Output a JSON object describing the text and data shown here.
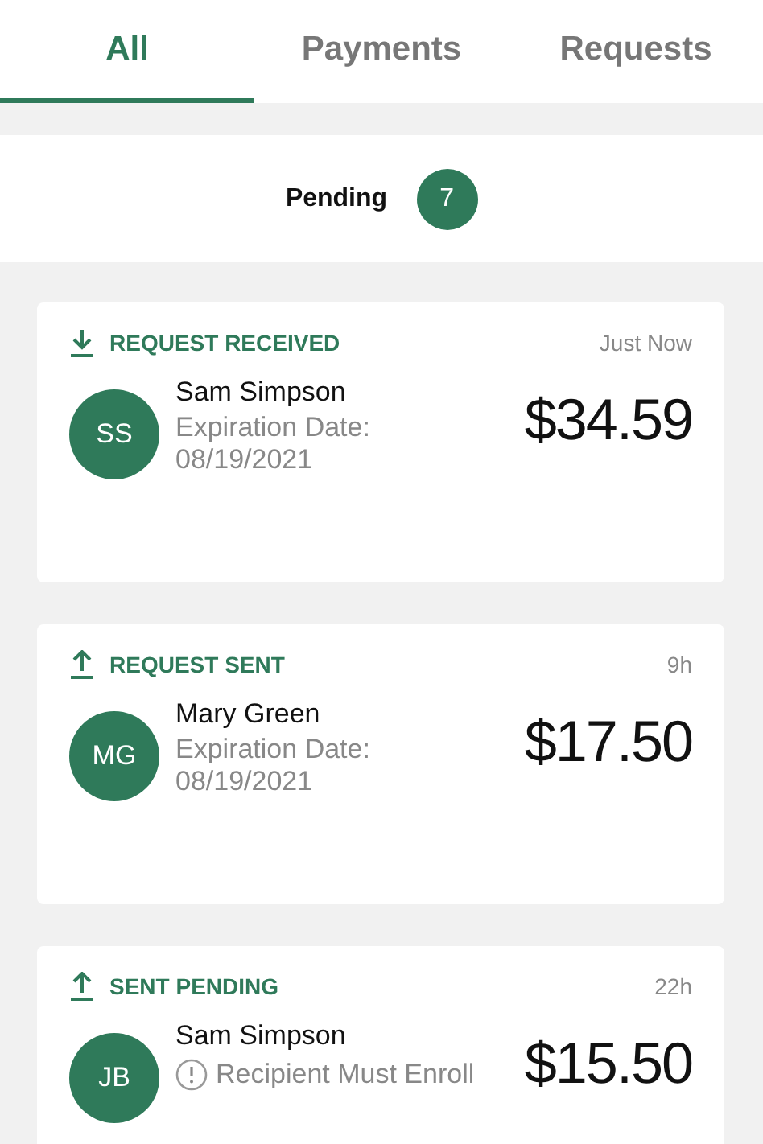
{
  "tabs": [
    {
      "label": "All",
      "selected": true
    },
    {
      "label": "Payments",
      "selected": false
    },
    {
      "label": "Requests",
      "selected": false
    }
  ],
  "pending": {
    "label": "Pending",
    "count": "7"
  },
  "transactions": [
    {
      "kind": "received",
      "status": "REQUEST RECEIVED",
      "time": "Just Now",
      "initials": "SS",
      "name": "Sam Simpson",
      "detail": {
        "kind": "plain",
        "text": "Expiration Date: 08/19/2021"
      },
      "amount": "$34.59"
    },
    {
      "kind": "sent",
      "status": "REQUEST SENT",
      "time": "9h",
      "initials": "MG",
      "name": "Mary Green",
      "detail": {
        "kind": "plain",
        "text": "Expiration Date: 08/19/2021"
      },
      "amount": "$17.50"
    },
    {
      "kind": "sent",
      "status": "SENT PENDING",
      "time": "22h",
      "initials": "JB",
      "name": "Sam Simpson",
      "detail": {
        "kind": "warning",
        "text": "Recipient Must Enroll"
      },
      "amount": "$15.50"
    }
  ]
}
